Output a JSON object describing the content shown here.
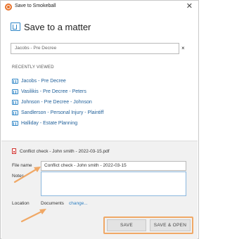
{
  "window": {
    "title": "Save to Smokeball",
    "close_glyph": "✕"
  },
  "heading": {
    "title": "Save to a matter",
    "icon": "matter-folder-icon"
  },
  "search": {
    "value": "Jacobs - Pre Decree",
    "clear_glyph": "×"
  },
  "recently_viewed": {
    "heading": "RECENTLY VIEWED",
    "items": [
      {
        "label": "Jacobs - Pre Decree"
      },
      {
        "label": "Vasilikis - Pre Decree - Peters"
      },
      {
        "label": "Johnson - Pre Decree - Johnson"
      },
      {
        "label": "Sandlerson - Personal Injury - Plaintiff"
      },
      {
        "label": "Halliday - Estate Planning"
      }
    ]
  },
  "document": {
    "file": "Conflict check - John smith - 2022-03-15.pdf",
    "file_name_label": "File name",
    "file_name_value": "Conflict check - John smith - 2022-03-15",
    "notes_label": "Notes",
    "notes_value": "",
    "location_label": "Location",
    "location_value": "Documents",
    "change_link": "change..."
  },
  "buttons": {
    "save": "SAVE",
    "save_open": "SAVE & OPEN"
  },
  "colors": {
    "accent": "#2f86c7",
    "link": "#2f7fc1",
    "annotation": "#f0a866",
    "pdf": "#d0312d"
  }
}
